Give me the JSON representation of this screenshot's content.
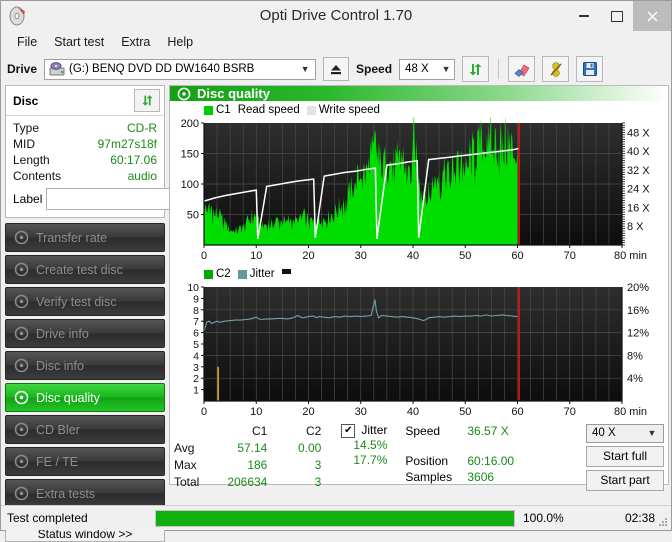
{
  "window": {
    "title": "Opti Drive Control 1.70",
    "app_icon": "disc-icon",
    "minimize": "–",
    "maximize": "□",
    "close": "×"
  },
  "menu": {
    "items": [
      "File",
      "Start test",
      "Extra",
      "Help"
    ]
  },
  "toolbar": {
    "drive_label": "Drive",
    "drive_value": "(G:)   BENQ DVD DD DW1640 BSRB",
    "eject_icon": "eject-icon",
    "speed_label": "Speed",
    "speed_value": "48 X",
    "refresh_icon": "refresh-icon",
    "erase_icon": "eraser-icon",
    "tools_icon": "tools-icon",
    "save_icon": "save-icon"
  },
  "disc_panel": {
    "title": "Disc",
    "refresh_icon": "refresh-icon",
    "rows": [
      {
        "key": "Type",
        "value": "CD-R"
      },
      {
        "key": "MID",
        "value": "97m27s18f"
      },
      {
        "key": "Length",
        "value": "60:17.06"
      },
      {
        "key": "Contents",
        "value": "audio"
      }
    ],
    "label_key": "Label",
    "label_value": "",
    "label_placeholder": "",
    "cd_icon": "cd-icon"
  },
  "nav": {
    "items": [
      {
        "label": "Transfer rate",
        "icon": "disc-icon",
        "active": false
      },
      {
        "label": "Create test disc",
        "icon": "disc-icon",
        "active": false
      },
      {
        "label": "Verify test disc",
        "icon": "disc-icon",
        "active": false
      },
      {
        "label": "Drive info",
        "icon": "disc-icon",
        "active": false
      },
      {
        "label": "Disc info",
        "icon": "disc-icon",
        "active": false
      },
      {
        "label": "Disc quality",
        "icon": "disc-icon",
        "active": true
      },
      {
        "label": "CD Bler",
        "icon": "disc-icon",
        "active": false
      },
      {
        "label": "FE / TE",
        "icon": "disc-icon",
        "active": false
      },
      {
        "label": "Extra tests",
        "icon": "disc-icon",
        "active": false
      }
    ],
    "status_window": "Status window >>"
  },
  "panel": {
    "title": "Disc quality",
    "icon": "disc-icon"
  },
  "stats": {
    "col_headers": [
      "C1",
      "C2"
    ],
    "rows": [
      {
        "label": "Avg",
        "c1": "57.14",
        "c2": "0.00",
        "jitter": "14.5%"
      },
      {
        "label": "Max",
        "c1": "186",
        "c2": "3",
        "jitter": "17.7%"
      },
      {
        "label": "Total",
        "c1": "206634",
        "c2": "3",
        "jitter": ""
      }
    ],
    "jitter_label": "Jitter",
    "jitter_checked": true,
    "jitter_check_glyph": "✔",
    "speed_label": "Speed",
    "speed_value": "36.57 X",
    "position_label": "Position",
    "position_value": "60:16.00",
    "samples_label": "Samples",
    "samples_value": "3606",
    "speed_select": "40 X",
    "start_full": "Start full",
    "start_part": "Start part"
  },
  "statusbar": {
    "text": "Test completed",
    "percent": "100.0%",
    "progress": 100,
    "time": "02:38"
  },
  "colors": {
    "c1_green": "#00dd00",
    "jitter_teal": "#5e9ba3",
    "read_speed_white": "#ffffff",
    "c2_orange": "#e8a020",
    "marker_red": "#ee1111",
    "value_green": "#1a8a1a",
    "accent_green": "#14a014",
    "plot_bg": "#1b1b1b"
  },
  "chart_data": [
    {
      "type": "area",
      "name": "c1-chart",
      "title": "",
      "xlabel": "min",
      "ylabel": "",
      "xlim": [
        0,
        80
      ],
      "ylim": [
        0,
        200
      ],
      "xticks": [
        0,
        10,
        20,
        30,
        40,
        50,
        60,
        70,
        80
      ],
      "xtick_labels": [
        "0",
        "10",
        "20",
        "30",
        "40",
        "50",
        "60",
        "70",
        "80 min"
      ],
      "yticks": [
        50,
        100,
        150,
        200
      ],
      "ytick_labels": [
        "50",
        "100",
        "150",
        "200"
      ],
      "y2_label": "X",
      "y2lim": [
        0,
        52
      ],
      "y2ticks": [
        8,
        16,
        24,
        32,
        40,
        48
      ],
      "y2tick_labels": [
        "8 X",
        "16 X",
        "24 X",
        "32 X",
        "40 X",
        "48 X"
      ],
      "grid": true,
      "legend": [
        {
          "label": "C1",
          "color": "#00cc00",
          "marker": "square"
        },
        {
          "label": "Read speed",
          "color": "#ffffff",
          "marker": "none"
        },
        {
          "label": "Write speed",
          "color": "#dddddd",
          "marker": "square"
        }
      ],
      "end_marker_x": 60.3,
      "series": [
        {
          "name": "C1",
          "kind": "area",
          "color": "#00dd00",
          "x": [
            0,
            0.6,
            1.2,
            1.8,
            2.4,
            3,
            3.6,
            4.2,
            4.8,
            5.4,
            6,
            6.6,
            7.2,
            7.8,
            8.4,
            9,
            9.6,
            10.2,
            10.8,
            11.4,
            12,
            12.6,
            13.2,
            13.8,
            14.4,
            15,
            15.6,
            16.2,
            16.8,
            17.4,
            18,
            18.6,
            19.2,
            19.8,
            20.4,
            21,
            21.6,
            22.2,
            22.8,
            23.4,
            24,
            24.6,
            25.2,
            25.8,
            26.4,
            27,
            27.6,
            28.2,
            28.8,
            29.4,
            30,
            30.6,
            31.2,
            31.8,
            32.4,
            33,
            33.6,
            34.2,
            34.8,
            35.4,
            36,
            36.6,
            37.2,
            37.8,
            38.4,
            39,
            39.6,
            40.2,
            40.8,
            41.4,
            42,
            42.6,
            43.2,
            43.8,
            44.4,
            45,
            45.6,
            46.2,
            46.8,
            47.4,
            48,
            48.6,
            49.2,
            49.8,
            50.4,
            51,
            51.6,
            52.2,
            52.8,
            53.4,
            54,
            54.6,
            55.2,
            55.8,
            56.4,
            57,
            57.6,
            58.2,
            58.8,
            59.4,
            60
          ],
          "y": [
            62,
            55,
            58,
            52,
            48,
            45,
            40,
            34,
            28,
            24,
            22,
            25,
            30,
            34,
            38,
            42,
            46,
            40,
            33,
            30,
            32,
            35,
            38,
            40,
            36,
            34,
            38,
            42,
            40,
            37,
            42,
            45,
            44,
            40,
            38,
            36,
            39,
            44,
            42,
            40,
            44,
            48,
            52,
            58,
            64,
            70,
            78,
            86,
            95,
            104,
            112,
            120,
            128,
            134,
            148,
            175,
            126,
            132,
            140,
            146,
            132,
            120,
            126,
            148,
            135,
            120,
            112,
            178,
            120,
            96,
            84,
            78,
            86,
            94,
            102,
            110,
            118,
            126,
            120,
            114,
            122,
            130,
            138,
            128,
            120,
            134,
            146,
            154,
            162,
            170,
            178,
            162,
            150,
            158,
            166,
            150,
            158,
            166,
            152,
            160,
            155
          ]
        },
        {
          "name": "Read speed",
          "kind": "line",
          "color": "#ffffff",
          "x": [
            0,
            2,
            4,
            6,
            8,
            10,
            10.3,
            12,
            14,
            16,
            18,
            20,
            21,
            21.3,
            23,
            25,
            27,
            29,
            31,
            32.8,
            33.1,
            35,
            37,
            39,
            40.8,
            41.1,
            43,
            45,
            47,
            49,
            51,
            53,
            55,
            57,
            59,
            60.2
          ],
          "y": [
            72,
            77,
            81,
            84,
            87,
            90,
            10,
            96,
            99,
            102,
            105,
            107,
            108,
            12,
            113,
            116,
            119,
            121,
            124,
            126,
            10,
            131,
            133,
            136,
            138,
            12,
            140,
            142,
            144,
            146,
            148,
            150,
            152,
            154,
            156,
            158
          ]
        }
      ]
    },
    {
      "type": "line",
      "name": "c2-jitter-chart",
      "title": "",
      "xlabel": "min",
      "ylabel": "",
      "xlim": [
        0,
        80
      ],
      "ylim": [
        0,
        10
      ],
      "xticks": [
        0,
        10,
        20,
        30,
        40,
        50,
        60,
        70,
        80
      ],
      "xtick_labels": [
        "0",
        "10",
        "20",
        "30",
        "40",
        "50",
        "60",
        "70",
        "80 min"
      ],
      "yticks": [
        1,
        2,
        3,
        4,
        5,
        6,
        7,
        8,
        9,
        10
      ],
      "ytick_labels": [
        "1",
        "2",
        "3",
        "4",
        "5",
        "6",
        "7",
        "8",
        "9",
        "10"
      ],
      "y2lim": [
        0,
        20
      ],
      "y2ticks": [
        4,
        8,
        12,
        16,
        20
      ],
      "y2tick_labels": [
        "4%",
        "8%",
        "12%",
        "16%",
        "20%"
      ],
      "grid": true,
      "legend": [
        {
          "label": "C2",
          "color": "#00cc00",
          "marker": "square"
        },
        {
          "label": "Jitter",
          "color": "#5e9ba3",
          "marker": "square"
        }
      ],
      "end_marker_x": 60.3,
      "series": [
        {
          "name": "Jitter",
          "kind": "line",
          "color": "#6fa3ab",
          "x": [
            0,
            0.5,
            1,
            1.5,
            2,
            2.5,
            3,
            4,
            5,
            6,
            7,
            8,
            9,
            10,
            10.5,
            11,
            12,
            13,
            14,
            15,
            16,
            17,
            18,
            18.5,
            19,
            20,
            21,
            21.5,
            22,
            23,
            24,
            25,
            26,
            27,
            28,
            29,
            30,
            31,
            32,
            32.7,
            33,
            33.4,
            34,
            35,
            36,
            37,
            38,
            39,
            40,
            41,
            42,
            42.5,
            43,
            44,
            45,
            46,
            47,
            48,
            49,
            50,
            51,
            52,
            53,
            54,
            55,
            56,
            57,
            58,
            59,
            60
          ],
          "y": [
            6.1,
            6.9,
            7.0,
            6.8,
            6.9,
            7.0,
            6.9,
            7.0,
            7.05,
            7.1,
            7.1,
            7.15,
            7.2,
            7.35,
            7.2,
            7.15,
            7.2,
            7.2,
            7.25,
            7.25,
            7.2,
            7.3,
            7.5,
            7.35,
            7.3,
            7.4,
            7.45,
            7.3,
            7.4,
            7.35,
            7.3,
            7.4,
            7.35,
            7.45,
            7.4,
            7.45,
            7.4,
            7.45,
            7.5,
            8.9,
            7.9,
            7.3,
            7.5,
            7.45,
            7.4,
            7.35,
            7.4,
            7.35,
            7.3,
            7.2,
            7.05,
            7.15,
            7.3,
            7.35,
            7.4,
            7.35,
            7.4,
            7.45,
            7.4,
            7.45,
            7.45,
            7.5,
            7.45,
            7.55,
            7.45,
            7.5,
            7.55,
            7.5,
            7.45,
            7.4
          ]
        },
        {
          "name": "C2",
          "kind": "spike",
          "color": "#e8a020",
          "x": [
            2.7
          ],
          "y": [
            3
          ]
        }
      ]
    }
  ]
}
